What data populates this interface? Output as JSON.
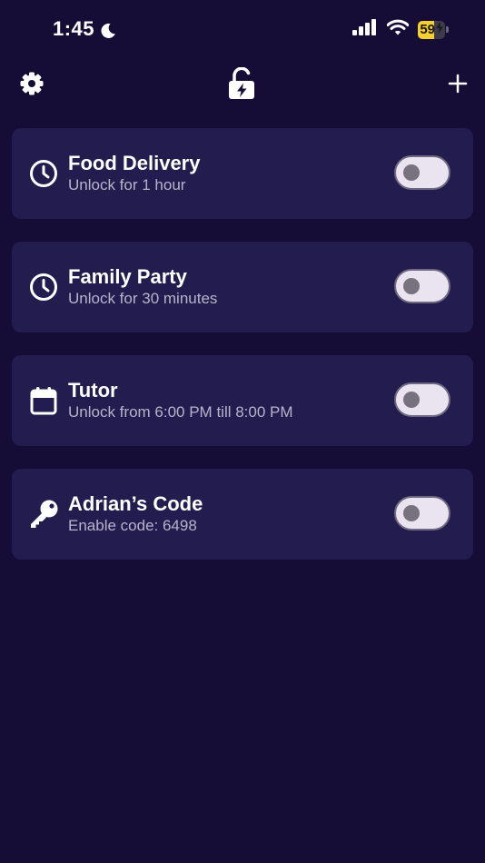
{
  "status_bar": {
    "time": "1:45",
    "moon_icon": "moon-icon",
    "signal_icon": "cellular-signal-icon",
    "wifi_icon": "wifi-icon",
    "battery_level": "59",
    "battery_percent": 59,
    "battery_charging": true,
    "battery_color": "#f5d02f"
  },
  "toolbar": {
    "settings_icon": "gear-icon",
    "center_icon": "lock-bolt-icon",
    "add_icon": "plus-icon"
  },
  "colors": {
    "background": "#150d36",
    "card": "#231c4e",
    "subtitle": "#b8b3cc",
    "toggle_track": "#e9e4ef",
    "toggle_knob": "#777280"
  },
  "items": [
    {
      "icon": "clock-icon",
      "title": "Food Delivery",
      "subtitle": "Unlock for 1 hour",
      "enabled": false
    },
    {
      "icon": "clock-icon",
      "title": "Family Party",
      "subtitle": "Unlock for 30 minutes",
      "enabled": false
    },
    {
      "icon": "calendar-icon",
      "title": "Tutor",
      "subtitle": "Unlock from 6:00 PM till 8:00 PM",
      "enabled": false
    },
    {
      "icon": "key-icon",
      "title": "Adrian’s Code",
      "subtitle": "Enable code: 6498",
      "enabled": false
    }
  ]
}
